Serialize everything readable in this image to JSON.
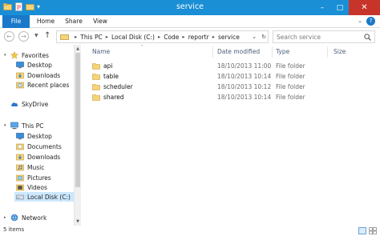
{
  "window": {
    "title": "service",
    "controls": {
      "minimize": "–",
      "maximize": "□",
      "close": "✕"
    }
  },
  "ribbon": {
    "tabs": [
      "File",
      "Home",
      "Share",
      "View"
    ],
    "help": "?"
  },
  "navigation": {
    "back": "←",
    "forward": "→",
    "breadcrumb": [
      "This PC",
      "Local Disk (C:)",
      "Code",
      "reportr",
      "service"
    ],
    "search_placeholder": "Search service"
  },
  "nav_pane": {
    "favorites": {
      "label": "Favorites",
      "items": [
        "Desktop",
        "Downloads",
        "Recent places"
      ]
    },
    "skydrive": "SkyDrive",
    "this_pc": {
      "label": "This PC",
      "items": [
        "Desktop",
        "Documents",
        "Downloads",
        "Music",
        "Pictures",
        "Videos",
        "Local Disk (C:)"
      ]
    },
    "network": "Network"
  },
  "file_list": {
    "columns": [
      "Name",
      "Date modified",
      "Type",
      "Size"
    ],
    "rows": [
      {
        "name": "api",
        "date": "18/10/2013 11:00 ...",
        "type": "File folder"
      },
      {
        "name": "table",
        "date": "18/10/2013 10:14 ...",
        "type": "File folder"
      },
      {
        "name": "scheduler",
        "date": "18/10/2013 10:12 ...",
        "type": "File folder"
      },
      {
        "name": "shared",
        "date": "18/10/2013 10:14 ...",
        "type": "File folder"
      }
    ]
  },
  "status": {
    "item_count": "5 items"
  },
  "colors": {
    "titlebar": "#1a8fd6",
    "file_tab": "#1a79c9",
    "close_button": "#c7352a",
    "folder": "#e8c25a",
    "selected": "#cce8ff"
  }
}
